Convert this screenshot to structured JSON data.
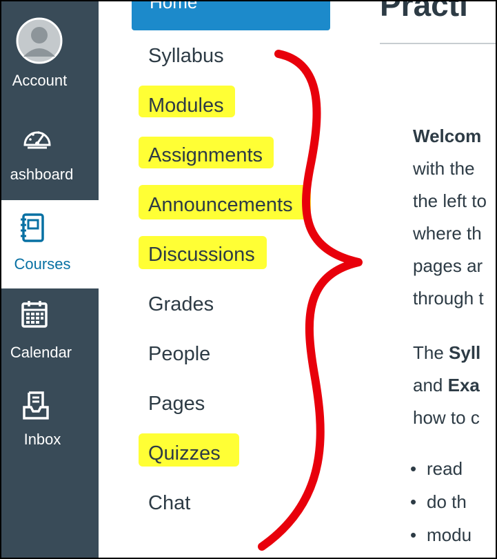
{
  "global_nav": {
    "items": [
      {
        "label": "Account",
        "icon": "avatar-icon"
      },
      {
        "label": "ashboard",
        "icon": "dashboard-gauge-icon"
      },
      {
        "label": "Courses",
        "icon": "courses-notebook-icon",
        "active": true
      },
      {
        "label": "Calendar",
        "icon": "calendar-icon"
      },
      {
        "label": "Inbox",
        "icon": "inbox-icon"
      }
    ]
  },
  "course_nav": {
    "home_label": "Home",
    "links": [
      {
        "label": "Syllabus",
        "highlighted": false
      },
      {
        "label": "Modules",
        "highlighted": true
      },
      {
        "label": "Assignments",
        "highlighted": true
      },
      {
        "label": "Announcements",
        "highlighted": true
      },
      {
        "label": "Discussions",
        "highlighted": true
      },
      {
        "label": "Grades",
        "highlighted": false
      },
      {
        "label": "People",
        "highlighted": false
      },
      {
        "label": "Pages",
        "highlighted": false
      },
      {
        "label": "Quizzes",
        "highlighted": true
      },
      {
        "label": "Chat",
        "highlighted": false
      }
    ]
  },
  "content": {
    "title": "Practi",
    "para1": {
      "bold": "Welcom",
      "lines": [
        "with the",
        "the left to",
        "where th",
        "pages ar",
        "through t"
      ]
    },
    "para2": {
      "line1_prefix": "The ",
      "line1_bold": "Syll",
      "line2_prefix": "and ",
      "line2_bold": "Exa",
      "line3": "how to c"
    },
    "bullets": [
      "read",
      "do th"
    ],
    "bullet2_cont": "modu"
  },
  "colors": {
    "global_nav_bg": "#394b58",
    "active_blue": "#0770a3",
    "home_tab_blue": "#1c8acb",
    "highlight_yellow": "#ffff35",
    "brace_red": "#e8000b"
  }
}
